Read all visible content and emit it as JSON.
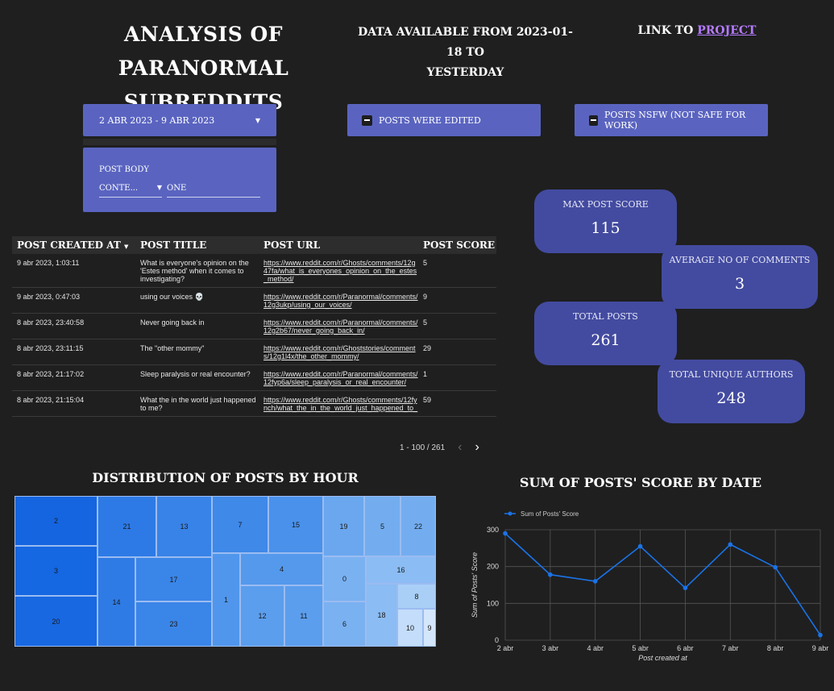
{
  "header": {
    "title_line1": "Analysis of paranormal",
    "title_line2": "subreddits",
    "subtitle_line1": "Data available from 2023-01-18 to",
    "subtitle_line2": "yesterday",
    "link_prefix": "Link to",
    "link_label": "project"
  },
  "filters": {
    "date_range": "2 abr 2023 - 9 abr 2023",
    "edited_label": "Posts were edited",
    "nsfw_label": "Posts NSFW (Not safe for work)",
    "body_label": "Post Body",
    "body_operator": "Conte...",
    "body_value": "one"
  },
  "table": {
    "headers": [
      "Post created at",
      "Post title",
      "Post URL",
      "Post score"
    ],
    "rows": [
      {
        "created": "9 abr 2023, 1:03:11",
        "title": "What is everyone's opinion on the 'Estes method' when it comes to investigating?",
        "url": "https://www.reddit.com/r/Ghosts/comments/12g47fa/what_is_everyones_opinion_on_the_estes_method/",
        "score": "5"
      },
      {
        "created": "9 abr 2023, 0:47:03",
        "title": "using our voices 💀",
        "url": "https://www.reddit.com/r/Paranormal/comments/12g3ukp/using_our_voices/",
        "score": "9"
      },
      {
        "created": "8 abr 2023, 23:40:58",
        "title": "Never going back in",
        "url": "https://www.reddit.com/r/Paranormal/comments/12g2b67/never_going_back_in/",
        "score": "5"
      },
      {
        "created": "8 abr 2023, 23:11:15",
        "title": "The \"other mommy\"",
        "url": "https://www.reddit.com/r/Ghoststories/comments/12g1l4x/the_other_mommy/",
        "score": "29"
      },
      {
        "created": "8 abr 2023, 21:17:02",
        "title": "Sleep paralysis or real encounter?",
        "url": "https://www.reddit.com/r/Paranormal/comments/12fyp6a/sleep_paralysis_or_real_encounter/",
        "score": "1"
      },
      {
        "created": "8 abr 2023, 21:15:04",
        "title": "What the in the world just happened to me?",
        "url": "https://www.reddit.com/r/Ghosts/comments/12fynch/what_the_in_the_world_just_happened_to_",
        "score": "59"
      }
    ],
    "pagination": "1 - 100 / 261"
  },
  "scorecards": {
    "max_label": "Max post score",
    "max_value": "115",
    "avg_label": "Average no of comments",
    "avg_value": "3",
    "total_label": "Total posts",
    "total_value": "261",
    "authors_label": "Total unique authors",
    "authors_value": "248"
  },
  "treemap": {
    "title": "Distribution of posts by hour",
    "tiles": [
      {
        "label": "2",
        "color": "#1565e0"
      },
      {
        "label": "3",
        "color": "#1567e2"
      },
      {
        "label": "20",
        "color": "#1868e2"
      },
      {
        "label": "21",
        "color": "#2d7ae6"
      },
      {
        "label": "13",
        "color": "#3883e8"
      },
      {
        "label": "14",
        "color": "#2f7be6"
      },
      {
        "label": "17",
        "color": "#3a85e8"
      },
      {
        "label": "23",
        "color": "#3a85e8"
      },
      {
        "label": "7",
        "color": "#3f89e9"
      },
      {
        "label": "15",
        "color": "#4a91eb"
      },
      {
        "label": "1",
        "color": "#5096ec"
      },
      {
        "label": "4",
        "color": "#5499ec"
      },
      {
        "label": "12",
        "color": "#5b9eed"
      },
      {
        "label": "11",
        "color": "#5b9eed"
      },
      {
        "label": "19",
        "color": "#6aa7ef"
      },
      {
        "label": "5",
        "color": "#73adf0"
      },
      {
        "label": "22",
        "color": "#73adf0"
      },
      {
        "label": "0",
        "color": "#7ab1f1"
      },
      {
        "label": "6",
        "color": "#7ab1f1"
      },
      {
        "label": "16",
        "color": "#8bbcf3"
      },
      {
        "label": "18",
        "color": "#8bbcf3"
      },
      {
        "label": "8",
        "color": "#a9cff7"
      },
      {
        "label": "10",
        "color": "#c3ddfa"
      },
      {
        "label": "9",
        "color": "#d4e6fc"
      }
    ]
  },
  "chart_data": {
    "type": "line",
    "title": "Sum of posts' score by date",
    "xlabel": "Post created at",
    "ylabel": "Sum of Posts' Score",
    "categories": [
      "2 abr",
      "3 abr",
      "4 abr",
      "5 abr",
      "6 abr",
      "7 abr",
      "8 abr",
      "9 abr"
    ],
    "series": [
      {
        "name": "Sum of Posts' Score",
        "values": [
          290,
          178,
          160,
          255,
          142,
          260,
          198,
          14
        ]
      }
    ],
    "ylim": [
      0,
      300
    ],
    "yticks": [
      0,
      100,
      200,
      300
    ],
    "grid": true,
    "legend": "top-left",
    "color": "#1a73e8"
  }
}
